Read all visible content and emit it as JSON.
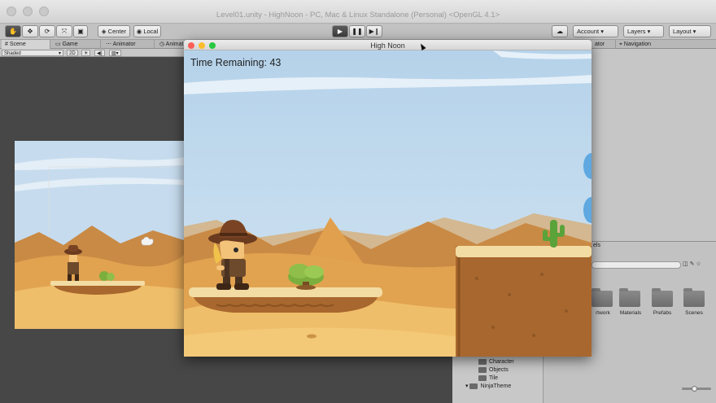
{
  "window": {
    "title": "Level01.unity - HighNoon - PC, Mac & Linux Standalone (Personal) <OpenGL 4.1>"
  },
  "toolbar": {
    "pivot_label": "Center",
    "space_label": "Local",
    "account_label": "Account",
    "layers_label": "Layers",
    "layout_label": "Layout"
  },
  "tabs": {
    "scene": "Scene",
    "game": "Game",
    "animator": "Animator",
    "animation": "Animat",
    "inspector": "ator",
    "navigation": "Navigation"
  },
  "scene_toolbar": {
    "shading": "Shaded",
    "mode_2d": "2D"
  },
  "game_window": {
    "title": "High Noon",
    "hud_text": "Time Remaining: 43"
  },
  "project": {
    "header_fragment": "els",
    "folders": [
      "rtwork",
      "Materials",
      "Prefabs",
      "Scenes"
    ],
    "tree": [
      "Character",
      "Objects",
      "Tile",
      "NinjaTheme"
    ]
  },
  "colors": {
    "sky": "#c5dcee",
    "dune_dark": "#c98a45",
    "dune_mid": "#e1a350",
    "sand_light": "#efbe6a",
    "platform_top": "#f2dca3",
    "platform_dirt": "#a8672e",
    "cactus": "#5aa33a"
  }
}
